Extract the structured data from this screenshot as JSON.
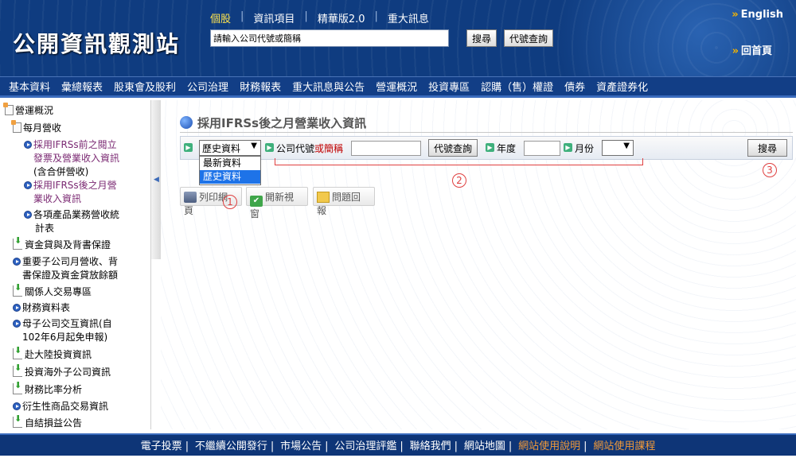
{
  "header": {
    "logo": "公開資訊觀測站",
    "top_nav": [
      "個股",
      "資訊項目",
      "精華版2.0",
      "重大訊息"
    ],
    "search_placeholder": "請輸入公司代號或簡稱",
    "search_button": "搜尋",
    "code_lookup_button": "代號查詢",
    "english_link": "English",
    "home_link": "回首頁"
  },
  "main_nav": [
    "基本資料",
    "彙總報表",
    "股東會及股利",
    "公司治理",
    "財務報表",
    "重大訊息與公告",
    "營運概況",
    "投資專區",
    "認購（售）權證",
    "債券",
    "資產證券化"
  ],
  "sidebar": {
    "root": "營運概況",
    "folder": "每月營收",
    "sub_items": [
      {
        "line1": "採用IFRSs前之閱立",
        "line2": "發票及營業收入資訊",
        "line3": "(含合併營收)"
      },
      {
        "line1": "採用IFRSs後之月營",
        "line2": "業收入資訊"
      },
      {
        "line1": "各項產品業務營收統",
        "line2": "計表"
      }
    ],
    "items": [
      {
        "line1": "資金貸與及背書保證"
      },
      {
        "line1": "重要子公司月營收、背",
        "line2": "書保證及資金貸放餘額"
      },
      {
        "line1": "關係人交易專區"
      },
      {
        "line1": "財務資料表"
      },
      {
        "line1": "母子公司交互資訊(自",
        "line2": "102年6月起免申報)"
      },
      {
        "line1": "赴大陸投資資訊"
      },
      {
        "line1": "投資海外子公司資訊"
      },
      {
        "line1": "財務比率分析"
      },
      {
        "line1": "衍生性商品交易資訊"
      },
      {
        "line1": "自結損益公告"
      }
    ]
  },
  "content": {
    "title": "採用IFRSs後之月營業收入資訊",
    "type_select_value": "歷史資料",
    "type_options": [
      "最新資料",
      "歷史資料"
    ],
    "company_label": "公司代號",
    "company_label_or": "或簡稱",
    "code_lookup_button": "代號查詢",
    "year_label": "年度",
    "month_label": "月份",
    "search_button": "搜尋",
    "print_button": "列印網頁",
    "new_window_button": "開新視窗",
    "feedback_button": "問題回報",
    "annotations": [
      "1",
      "2",
      "3"
    ]
  },
  "footer": {
    "links": [
      "電子投票",
      "不繼續公開發行",
      "市場公告",
      "公司治理評鑑",
      "聯絡我們",
      "網站地圖",
      "網站使用說明",
      "網站使用課程"
    ],
    "highlight_color": "#f29a38"
  }
}
